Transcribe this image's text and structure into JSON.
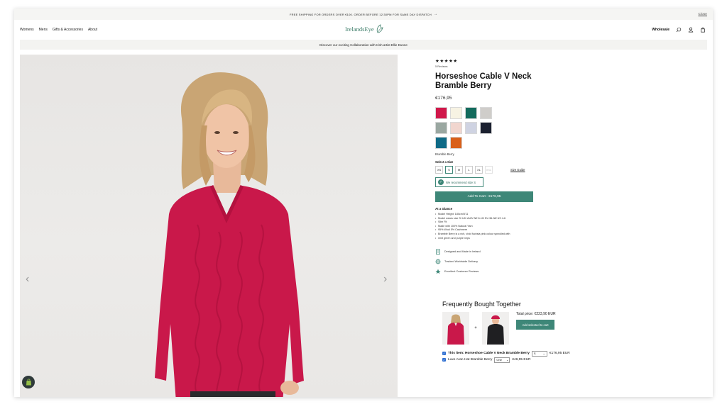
{
  "announcement": {
    "text": "FREE SHIPPING FOR ORDERS OVER €100. ORDER BEFORE 12:30PM FOR SAME DAY DISPATCH",
    "close": "Close"
  },
  "nav": {
    "links": [
      "Womens",
      "Mens",
      "Gifts & Accessories",
      "About"
    ],
    "brand": "IrelandsEye",
    "wholesale": "Wholesale"
  },
  "collab": {
    "text": "Discover our exciting Collaboration with Irish artist Ellie Dunne"
  },
  "product": {
    "stars": "★★★★★",
    "reviews": "5 Reviews",
    "title": "Horseshoe Cable V Neck Bramble Berry",
    "price": "€176,95",
    "swatch_colors": [
      "#d0174a",
      "#f7f3e3",
      "#136b5d",
      "#cfcdca",
      "#9aa7a1",
      "#f1d6cf",
      "#cfd3e2",
      "#1b2030",
      "#0f6a86",
      "#d9601a"
    ],
    "selected_color_name": "Bramble Berry",
    "size_label": "Select a Size",
    "sizes": [
      "XS",
      "S",
      "M",
      "L",
      "XL",
      "XXL"
    ],
    "selected_size": "S",
    "size_guide": "Size Guide",
    "recommend": "We recommend size S",
    "add_to_cart": "Add To Cart - €176,95",
    "glance_title": "At a Glance",
    "glance": [
      "Model Height: 180cm/5'11",
      "Model wears size S/ UK/ AUS/ NZ 8-10/ EU 36-38/ US 4-6",
      "Slim Fit",
      "Made with 100% Natural Yarn",
      "95% Wool 5% Cashmere",
      "Bramble Berry is a rich, vivid fuchsia pink colour speckled with",
      "mint green and purple neps"
    ],
    "features": [
      "Designed and Made in Ireland",
      "Tracked Worldwide Delivery",
      "Excellent Customer Reviews"
    ]
  },
  "fbt": {
    "title": "Frequently Bought Together",
    "total": "Total price: €223,90 EUR",
    "add_selected": "Add selected to cart",
    "item1_label": "This item: Horseshoe Cable V Neck Bramble Berry",
    "item1_option": "S",
    "item1_price": "€176,95 EUR",
    "item2_label": "Luxe Aran Hat Bramble Berry",
    "item2_option": "One",
    "item2_price": "€46,95 EUR"
  },
  "accent_color": "#3e8778"
}
